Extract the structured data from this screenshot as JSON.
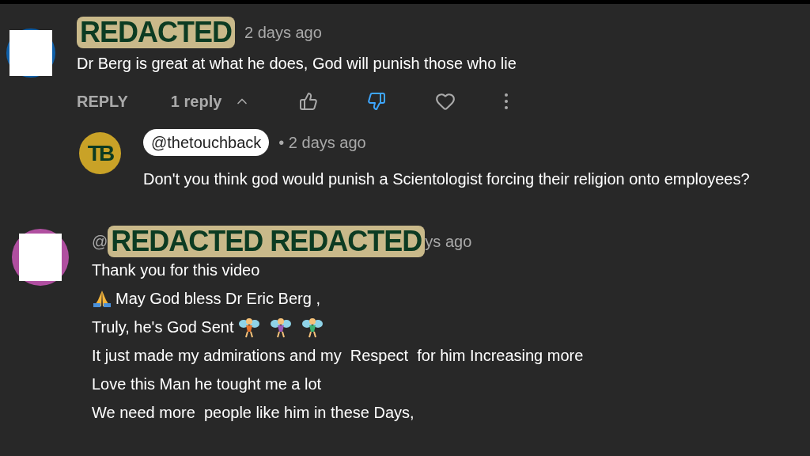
{
  "comments": [
    {
      "author": {
        "redaction": "REDACTED"
      },
      "time": "2 days ago",
      "avatar": {
        "color": "#0f5fa8"
      },
      "lines": [
        [
          {
            "kind": "text",
            "text": "Dr Berg is great at what he does, God will punish those who lie"
          }
        ]
      ],
      "actions": {
        "reply": "REPLY",
        "replies": {
          "label": "1 reply",
          "expanded": true
        },
        "liked": false,
        "disliked": true,
        "hearted": false
      },
      "replies": [
        {
          "author": {
            "handle": "@thetouchback"
          },
          "avatar": {
            "initials": "TB",
            "color": "#c9a227"
          },
          "time": "• 2 days ago",
          "lines": [
            [
              {
                "kind": "text",
                "text": "Don't you think god would punish a Scientologist forcing their religion onto employees?"
              }
            ]
          ]
        }
      ]
    },
    {
      "author": {
        "prefix": "@",
        "redaction": "REDACTED REDACTED",
        "suffix": "ys ago"
      },
      "avatar": {
        "color": "#b04fa0"
      },
      "lines": [
        [
          {
            "kind": "text",
            "text": "Thank you for this video"
          }
        ],
        [
          {
            "kind": "pray"
          },
          {
            "kind": "text",
            "text": "May God bless Dr Eric Berg ,"
          }
        ],
        [
          {
            "kind": "text",
            "text": "Truly, he's God Sent "
          },
          {
            "kind": "fairy",
            "color": "#e8742c"
          },
          {
            "kind": "fairy",
            "color": "#9b59b6"
          },
          {
            "kind": "fairy",
            "color": "#3cb371"
          }
        ],
        [
          {
            "kind": "text",
            "text": "It just made my admirations and my  Respect  for him Increasing more"
          }
        ],
        [
          {
            "kind": "text",
            "text": "Love this Man he tought me a lot"
          }
        ],
        [
          {
            "kind": "text",
            "text": "We need more  people like him in these Days,"
          }
        ]
      ]
    }
  ]
}
